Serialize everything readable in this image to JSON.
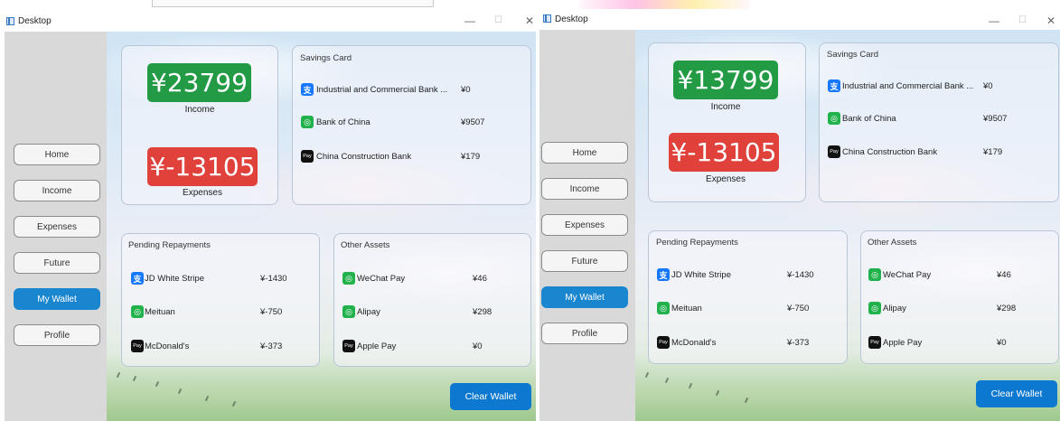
{
  "screens": [
    {
      "window_title": "Desktop",
      "nav": [
        "Home",
        "Income",
        "Expenses",
        "Future",
        "My Wallet",
        "Profile"
      ],
      "active_nav": "My Wallet",
      "income": {
        "amount": "¥23799",
        "label": "Income"
      },
      "expenses": {
        "amount": "¥-13105",
        "label": "Expenses"
      },
      "savings_card": {
        "title": "Savings Card",
        "rows": [
          {
            "icon": "alipay-icon",
            "name": "Industrial and Commercial Bank ...",
            "value": "¥0"
          },
          {
            "icon": "green-pay-icon",
            "name": "Bank of China",
            "value": "¥9507"
          },
          {
            "icon": "apple-pay-icon",
            "name": "China Construction Bank",
            "value": "¥179"
          }
        ]
      },
      "pending_repayments": {
        "title": "Pending Repayments",
        "rows": [
          {
            "icon": "alipay-icon",
            "name": "JD White Stripe",
            "value": "¥-1430"
          },
          {
            "icon": "green-pay-icon",
            "name": "Meituan",
            "value": "¥-750"
          },
          {
            "icon": "apple-pay-icon",
            "name": "McDonald's",
            "value": "¥-373"
          }
        ]
      },
      "other_assets": {
        "title": "Other Assets",
        "rows": [
          {
            "icon": "green-pay-icon",
            "name": "WeChat Pay",
            "value": "¥46"
          },
          {
            "icon": "green-pay-icon",
            "name": "Alipay",
            "value": "¥298"
          },
          {
            "icon": "apple-pay-icon",
            "name": "Apple Pay",
            "value": "¥0"
          }
        ]
      },
      "clear_button": "Clear Wallet"
    },
    {
      "window_title": "Desktop",
      "nav": [
        "Home",
        "Income",
        "Expenses",
        "Future",
        "My Wallet",
        "Profile"
      ],
      "active_nav": "My Wallet",
      "income": {
        "amount": "¥13799",
        "label": "Income"
      },
      "expenses": {
        "amount": "¥-13105",
        "label": "Expenses"
      },
      "savings_card": {
        "title": "Savings Card",
        "rows": [
          {
            "icon": "alipay-icon",
            "name": "Industrial and Commercial Bank ...",
            "value": "¥0"
          },
          {
            "icon": "green-pay-icon",
            "name": "Bank of China",
            "value": "¥9507"
          },
          {
            "icon": "apple-pay-icon",
            "name": "China Construction Bank",
            "value": "¥179"
          }
        ]
      },
      "pending_repayments": {
        "title": "Pending Repayments",
        "rows": [
          {
            "icon": "alipay-icon",
            "name": "JD White Stripe",
            "value": "¥-1430"
          },
          {
            "icon": "green-pay-icon",
            "name": "Meituan",
            "value": "¥-750"
          },
          {
            "icon": "apple-pay-icon",
            "name": "McDonald's",
            "value": "¥-373"
          }
        ]
      },
      "other_assets": {
        "title": "Other Assets",
        "rows": [
          {
            "icon": "green-pay-icon",
            "name": "WeChat Pay",
            "value": "¥46"
          },
          {
            "icon": "green-pay-icon",
            "name": "Alipay",
            "value": "¥298"
          },
          {
            "icon": "apple-pay-icon",
            "name": "Apple Pay",
            "value": "¥0"
          }
        ]
      },
      "clear_button": "Clear Wallet"
    }
  ],
  "icon_glyphs": {
    "alipay-icon": "支",
    "green-pay-icon": "◎",
    "apple-pay-icon": "Pay"
  },
  "colors": {
    "income": "#239b45",
    "expenses": "#e0413a",
    "active_nav": "#1a86cf",
    "clear_button": "#0d78d0"
  }
}
